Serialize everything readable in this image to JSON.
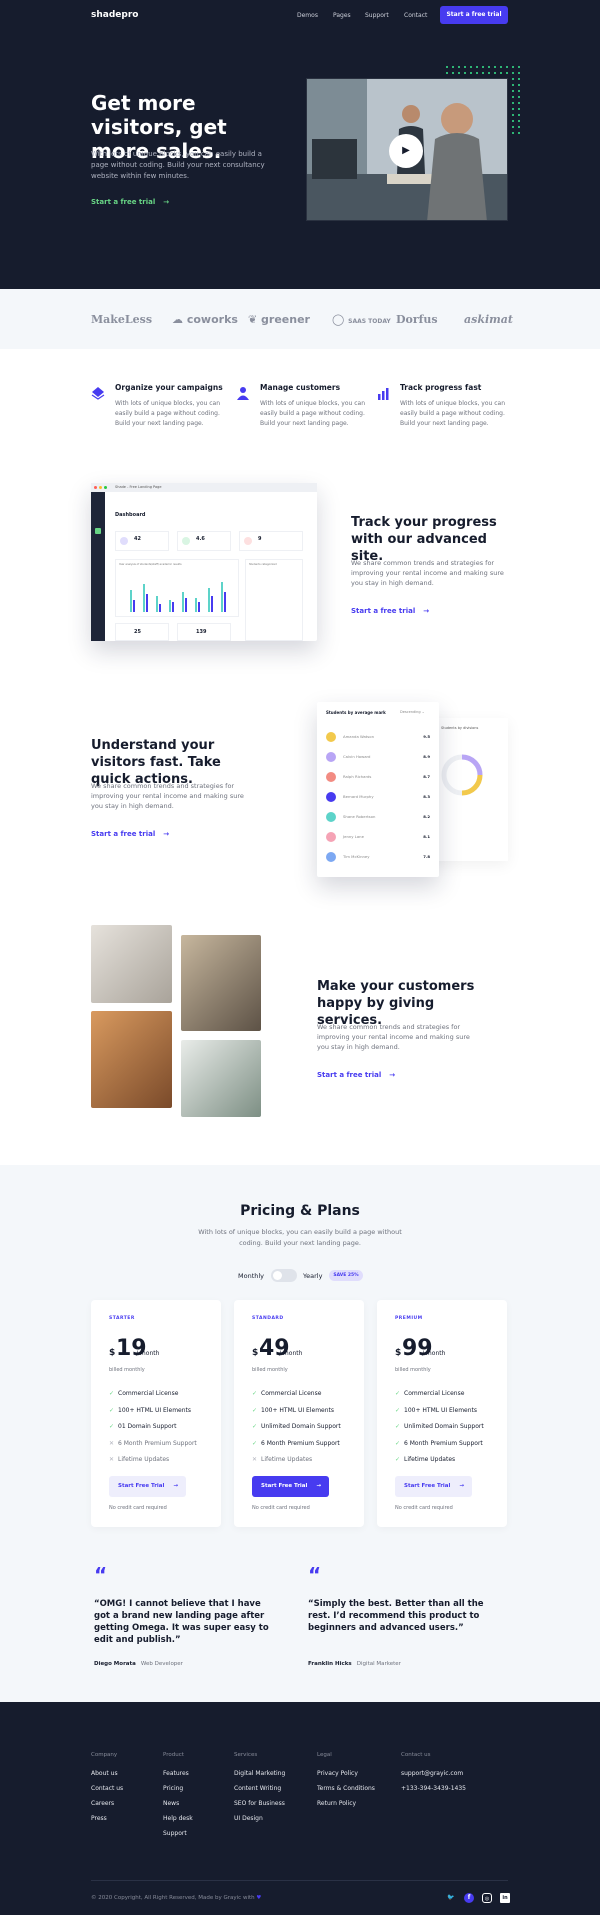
{
  "colors": {
    "primary": "#473bf0",
    "dark": "#161c2d",
    "green": "#68d585",
    "light_bg": "#f4f7fa"
  },
  "header": {
    "logo": "shadepro",
    "nav": [
      "Demos",
      "Pages",
      "Support",
      "Contact"
    ],
    "cta": "Start a free trial"
  },
  "hero": {
    "title": "Get more visitors, get more sales.",
    "subtitle": "With lots of unique blocks, you can easily build a page without coding. Build your next consultancy website within few minutes.",
    "cta": "Start a free trial",
    "play_icon": "play-icon"
  },
  "logos": [
    "MakeLess",
    "coworks",
    "greener",
    "SAAS TODAY",
    "Dorfus",
    "askimat"
  ],
  "features": [
    {
      "title": "Organize your campaigns",
      "desc": "With lots of unique blocks, you can easily build a page without coding. Build your next landing page.",
      "icon": "layers-icon"
    },
    {
      "title": "Manage customers",
      "desc": "With lots of unique blocks, you can easily build a page without coding. Build your next landing page.",
      "icon": "user-icon"
    },
    {
      "title": "Track progress fast",
      "desc": "With lots of unique blocks, you can easily build a page without coding. Build your next landing page.",
      "icon": "chart-icon"
    }
  ],
  "section1": {
    "title": "Track your progress with our advanced site.",
    "desc": "We share common trends and strategies for improving your rental income and making sure you stay in high demand.",
    "cta": "Start a free trial",
    "mock": {
      "tab": "Shade - Free Landing Page",
      "title": "Dashboard",
      "stats": [
        "42",
        "4.6",
        "9",
        "25",
        "139"
      ],
      "chart_label": "Year analysis of students/staff/ academic results",
      "side_label": "Students categorized"
    }
  },
  "section2": {
    "title": "Understand your visitors fast. Take quick actions.",
    "desc": "We share common trends and strategies for improving your rental income and making sure you stay in high demand.",
    "cta": "Start a free trial",
    "mock": {
      "title": "Students by average mark",
      "filter": "Descending",
      "rows": [
        {
          "name": "Amanda Watson",
          "score": "9.5"
        },
        {
          "name": "Calvin Howard",
          "score": "8.9"
        },
        {
          "name": "Ralph Richards",
          "score": "8.7"
        },
        {
          "name": "Bernard Murphy",
          "score": "8.3"
        },
        {
          "name": "Shane Robertson",
          "score": "8.2"
        },
        {
          "name": "Jenny Lane",
          "score": "8.1"
        },
        {
          "name": "Tim McKinney",
          "score": "7.8"
        }
      ],
      "side_title": "Students by divisions"
    }
  },
  "section3": {
    "title": "Make your customers happy by giving services.",
    "desc": "We share common trends and strategies for improving your rental income and making sure you stay in high demand.",
    "cta": "Start a free trial"
  },
  "pricing": {
    "title": "Pricing & Plans",
    "subtitle": "With lots of unique blocks, you can easily build a page without coding. Build your next landing page.",
    "monthly": "Monthly",
    "yearly": "Yearly",
    "save": "SAVE 25%",
    "plans": [
      {
        "tier": "STARTER",
        "currency": "$",
        "price": "19",
        "per": "/ month",
        "billed": "billed monthly",
        "features": [
          {
            "t": "Commercial License",
            "on": true
          },
          {
            "t": "100+ HTML UI Elements",
            "on": true
          },
          {
            "t": "01 Domain Support",
            "on": true
          },
          {
            "t": "6 Month Premium Support",
            "on": false
          },
          {
            "t": "Lifetime Updates",
            "on": false
          }
        ],
        "button": "Start Free Trial",
        "note": "No credit card required"
      },
      {
        "tier": "STANDARD",
        "currency": "$",
        "price": "49",
        "per": "/ month",
        "billed": "billed monthly",
        "features": [
          {
            "t": "Commercial License",
            "on": true
          },
          {
            "t": "100+ HTML UI Elements",
            "on": true
          },
          {
            "t": "Unlimited Domain Support",
            "on": true
          },
          {
            "t": "6 Month Premium Support",
            "on": true
          },
          {
            "t": "Lifetime Updates",
            "on": false
          }
        ],
        "button": "Start Free Trial",
        "note": "No credit card required"
      },
      {
        "tier": "PREMIUM",
        "currency": "$",
        "price": "99",
        "per": "/ month",
        "billed": "billed monthly",
        "features": [
          {
            "t": "Commercial License",
            "on": true
          },
          {
            "t": "100+ HTML UI Elements",
            "on": true
          },
          {
            "t": "Unlimited Domain Support",
            "on": true
          },
          {
            "t": "6 Month Premium Support",
            "on": true
          },
          {
            "t": "Lifetime Updates",
            "on": true
          }
        ],
        "button": "Start Free Trial",
        "note": "No credit card required"
      }
    ]
  },
  "testimonials": [
    {
      "quote": "“OMG! I cannot believe that I have got a brand new landing page after getting Omega. It was super easy to edit and publish.”",
      "name": "Diego Morata",
      "role": "Web Developer"
    },
    {
      "quote": "“Simply the best. Better than all the rest. I’d recommend this product to beginners and advanced users.”",
      "name": "Franklin Hicks",
      "role": "Digital Marketer"
    }
  ],
  "footer": {
    "columns": [
      {
        "head": "Company",
        "links": [
          "About us",
          "Contact us",
          "Careers",
          "Press"
        ]
      },
      {
        "head": "Product",
        "links": [
          "Features",
          "Pricing",
          "News",
          "Help desk",
          "Support"
        ]
      },
      {
        "head": "Services",
        "links": [
          "Digital Marketing",
          "Content Writing",
          "SEO for Business",
          "UI Design"
        ]
      },
      {
        "head": "Legal",
        "links": [
          "Privacy Policy",
          "Terms & Conditions",
          "Return Policy"
        ]
      },
      {
        "head": "Contact us",
        "links": [
          "support@grayic.com",
          "+133-394-3439-1435"
        ]
      }
    ],
    "copyright": "© 2020 Copyright, All Right Reserved, Made by Grayic with",
    "social": [
      "twitter-icon",
      "facebook-icon",
      "instagram-icon",
      "linkedin-icon"
    ]
  }
}
